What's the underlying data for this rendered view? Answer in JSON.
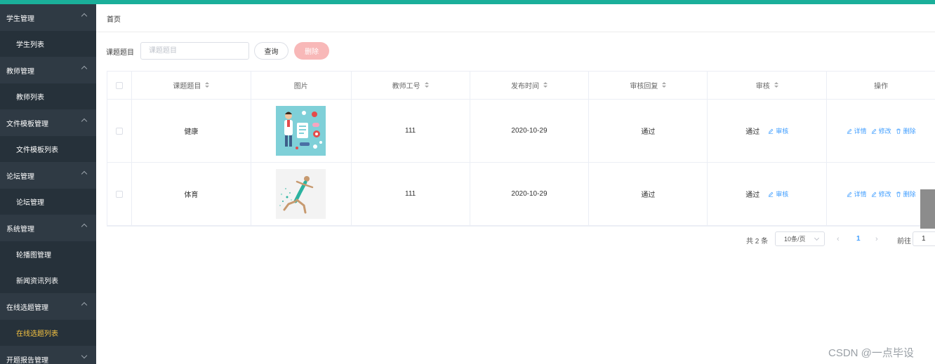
{
  "sidebar": {
    "groups": [
      {
        "label": "学生管理",
        "items": [
          {
            "label": "学生列表"
          }
        ]
      },
      {
        "label": "教师管理",
        "items": [
          {
            "label": "教师列表"
          }
        ]
      },
      {
        "label": "文件模板管理",
        "items": [
          {
            "label": "文件模板列表"
          }
        ]
      },
      {
        "label": "论坛管理",
        "items": [
          {
            "label": "论坛管理"
          }
        ]
      },
      {
        "label": "系统管理",
        "items": [
          {
            "label": "轮播图管理"
          },
          {
            "label": "新闻资讯列表"
          }
        ]
      },
      {
        "label": "在线选题管理",
        "items": [
          {
            "label": "在线选题列表"
          }
        ]
      }
    ],
    "partial_group": "开题报告管理",
    "active_item": "在线选题列表",
    "active_color": "#f5c342"
  },
  "breadcrumb": "首页",
  "filter": {
    "label": "课题题目",
    "placeholder": "课题题目",
    "query_label": "查询",
    "delete_label": "删除"
  },
  "table": {
    "columns": [
      "课题题目",
      "图片",
      "教师工号",
      "发布时间",
      "审核回复",
      "审核",
      "操作"
    ],
    "rows": [
      {
        "title": "健康",
        "image": "health-illustration",
        "teacher_no": "111",
        "date": "2020-10-29",
        "reply": "通过",
        "audit_status": "通过",
        "audit_action": "审核"
      },
      {
        "title": "体育",
        "image": "sprinter-illustration",
        "teacher_no": "111",
        "date": "2020-10-29",
        "reply": "通过",
        "audit_status": "通过",
        "audit_action": "审核"
      }
    ],
    "actions": {
      "detail": "详情",
      "edit": "修改",
      "delete": "删除"
    }
  },
  "pagination": {
    "total": "共 2 条",
    "page_size": "10条/页",
    "current_page": "1",
    "goto_label": "前往",
    "goto_value": "1"
  },
  "watermark": "CSDN @一点毕设",
  "colors": {
    "accent": "#1aaf9a",
    "link": "#409eff",
    "sidebar_bg": "#2f3a44",
    "delete_btn": "#f8b8b8"
  }
}
